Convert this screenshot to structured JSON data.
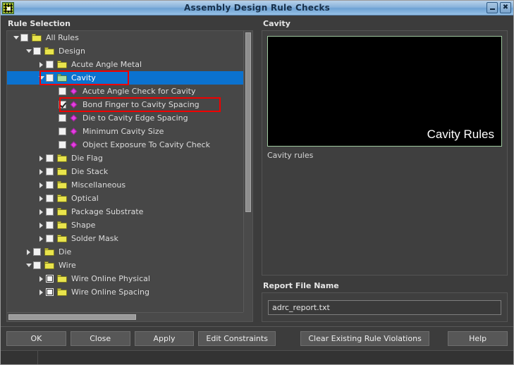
{
  "window": {
    "title": "Assembly Design Rule Checks",
    "app_icon": "grid-icon",
    "minimize_label": "minimize-icon",
    "close_label": "close-icon",
    "close_glyph": "✖"
  },
  "left_panel": {
    "title": "Rule Selection",
    "tree": [
      {
        "label": "All Rules",
        "indent": 0,
        "twisty": "open",
        "check": "unchecked",
        "icon": "folder-yellow",
        "selected": false
      },
      {
        "label": "Design",
        "indent": 1,
        "twisty": "open",
        "check": "unchecked",
        "icon": "folder-yellow",
        "selected": false
      },
      {
        "label": "Acute Angle Metal",
        "indent": 2,
        "twisty": "closed",
        "check": "unchecked",
        "icon": "folder-yellow",
        "selected": false
      },
      {
        "label": "Cavity",
        "indent": 2,
        "twisty": "open",
        "check": "unchecked",
        "icon": "folder-green",
        "selected": true
      },
      {
        "label": "Acute Angle Check for Cavity",
        "indent": 3,
        "twisty": "none",
        "check": "unchecked",
        "icon": "diamond-magenta",
        "selected": false
      },
      {
        "label": "Bond Finger to Cavity Spacing",
        "indent": 3,
        "twisty": "none",
        "check": "checked",
        "icon": "diamond-magenta",
        "selected": false
      },
      {
        "label": "Die to Cavity Edge Spacing",
        "indent": 3,
        "twisty": "none",
        "check": "unchecked",
        "icon": "diamond-magenta",
        "selected": false
      },
      {
        "label": "Minimum Cavity Size",
        "indent": 3,
        "twisty": "none",
        "check": "unchecked",
        "icon": "diamond-magenta",
        "selected": false
      },
      {
        "label": "Object Exposure To Cavity Check",
        "indent": 3,
        "twisty": "none",
        "check": "unchecked",
        "icon": "diamond-magenta",
        "selected": false
      },
      {
        "label": "Die Flag",
        "indent": 2,
        "twisty": "closed",
        "check": "unchecked",
        "icon": "folder-yellow",
        "selected": false
      },
      {
        "label": "Die Stack",
        "indent": 2,
        "twisty": "closed",
        "check": "unchecked",
        "icon": "folder-yellow",
        "selected": false
      },
      {
        "label": "Miscellaneous",
        "indent": 2,
        "twisty": "closed",
        "check": "unchecked",
        "icon": "folder-yellow",
        "selected": false
      },
      {
        "label": "Optical",
        "indent": 2,
        "twisty": "closed",
        "check": "unchecked",
        "icon": "folder-yellow",
        "selected": false
      },
      {
        "label": "Package Substrate",
        "indent": 2,
        "twisty": "closed",
        "check": "unchecked",
        "icon": "folder-yellow",
        "selected": false
      },
      {
        "label": "Shape",
        "indent": 2,
        "twisty": "closed",
        "check": "unchecked",
        "icon": "folder-yellow",
        "selected": false
      },
      {
        "label": "Solder Mask",
        "indent": 2,
        "twisty": "closed",
        "check": "unchecked",
        "icon": "folder-yellow",
        "selected": false
      },
      {
        "label": "Die",
        "indent": 1,
        "twisty": "closed",
        "check": "unchecked",
        "icon": "folder-yellow",
        "selected": false
      },
      {
        "label": "Wire",
        "indent": 1,
        "twisty": "open",
        "check": "unchecked",
        "icon": "folder-yellow",
        "selected": false
      },
      {
        "label": "Wire Online Physical",
        "indent": 2,
        "twisty": "closed",
        "check": "inner",
        "icon": "folder-yellow",
        "selected": false
      },
      {
        "label": "Wire Online Spacing",
        "indent": 2,
        "twisty": "closed",
        "check": "inner",
        "icon": "folder-yellow",
        "selected": false
      }
    ],
    "scroll": {
      "vertical_thumb_pct": 64,
      "horizontal_thumb_pct": 54
    }
  },
  "right_panel": {
    "title": "Cavity",
    "preview_caption": "Cavity Rules",
    "description": "Cavity rules",
    "report": {
      "title": "Report File Name",
      "value": "adrc_report.txt",
      "placeholder": "Report file name"
    }
  },
  "buttons": [
    {
      "label": "OK",
      "fixed": true
    },
    {
      "label": "Close",
      "fixed": true
    },
    {
      "label": "Apply",
      "fixed": true
    },
    {
      "label": "Edit Constraints",
      "fixed": false
    },
    {
      "label": "Clear Existing Rule Violations",
      "fixed": false
    },
    {
      "label": "Help",
      "fixed": true
    }
  ],
  "colors": {
    "selection_blue": "#0b72cf",
    "annotation_red": "#f00000",
    "folder_yellow": "#e9e44c",
    "folder_green": "#a9dfa0",
    "diamond_magenta": "#e43fe0",
    "titlebar_blue": "#8ab3dc"
  }
}
